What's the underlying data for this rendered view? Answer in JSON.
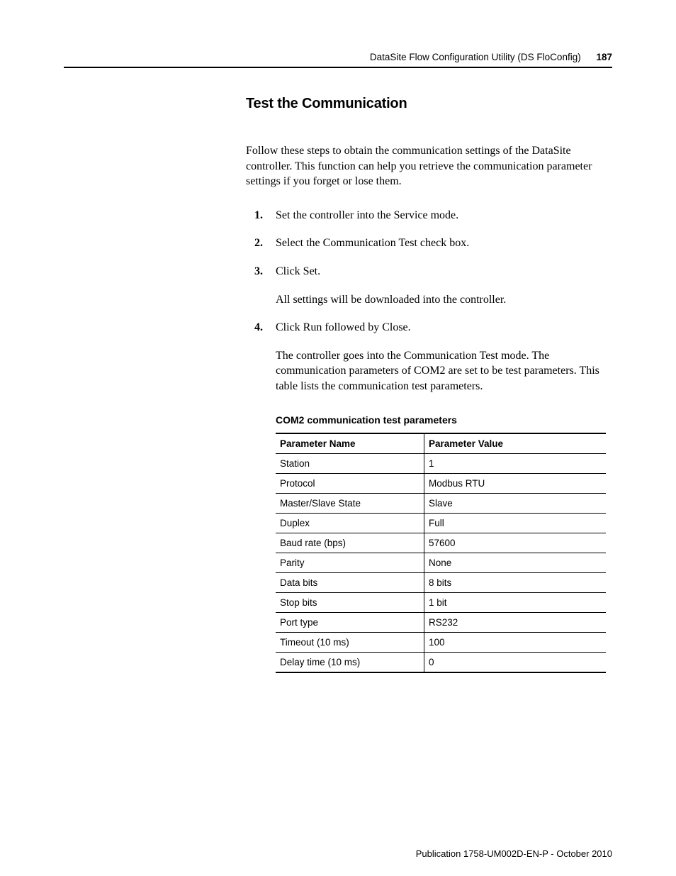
{
  "header": {
    "title": "DataSite Flow Configuration Utility (DS FloConfig)",
    "page_number": "187"
  },
  "section": {
    "title": "Test the Communication",
    "intro": "Follow these steps to obtain the communication settings of the DataSite controller. This function can help you retrieve the communication parameter settings if you forget or lose them."
  },
  "steps": [
    {
      "num": "1.",
      "text": "Set the controller into the Service mode."
    },
    {
      "num": "2.",
      "text": "Select the Communication Test check box."
    },
    {
      "num": "3.",
      "text": "Click Set.",
      "sub": "All settings will be downloaded into the controller."
    },
    {
      "num": "4.",
      "text": "Click Run followed by Close.",
      "sub": "The controller goes into the Communication Test mode. The communication parameters of COM2 are set to be test parameters. This table lists the communication test parameters."
    }
  ],
  "table": {
    "caption": "COM2 communication test parameters",
    "headers": [
      "Parameter Name",
      "Parameter Value"
    ],
    "rows": [
      [
        "Station",
        "1"
      ],
      [
        "Protocol",
        "Modbus RTU"
      ],
      [
        "Master/Slave State",
        "Slave"
      ],
      [
        "Duplex",
        "Full"
      ],
      [
        "Baud rate (bps)",
        "57600"
      ],
      [
        "Parity",
        "None"
      ],
      [
        "Data bits",
        "8 bits"
      ],
      [
        "Stop bits",
        "1 bit"
      ],
      [
        "Port type",
        "RS232"
      ],
      [
        "Timeout (10 ms)",
        "100"
      ],
      [
        "Delay time (10 ms)",
        "0"
      ]
    ]
  },
  "footer": {
    "text": "Publication 1758-UM002D-EN-P - October 2010"
  }
}
